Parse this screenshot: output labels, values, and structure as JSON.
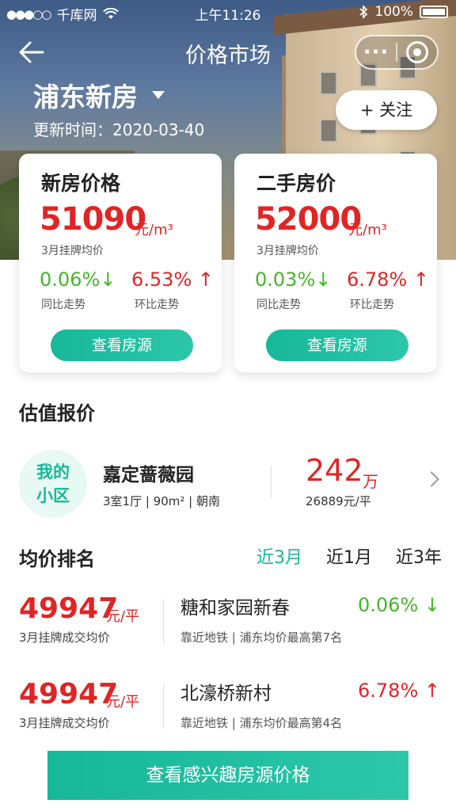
{
  "status_bar": {
    "carrier": "千库网",
    "time": "上午11:26",
    "battery": "100%"
  },
  "nav": {
    "title": "价格市场"
  },
  "header": {
    "district": "浦东新房",
    "updated": "更新时间：2020-03-40",
    "follow_label": "+ 关注"
  },
  "cards": [
    {
      "title": "新房价格",
      "price": "51090",
      "unit": "元/m³",
      "price_label": "3月挂牌均价",
      "yoy": "0.06%",
      "yoy_arrow": "↓",
      "yoy_label": "同比走势",
      "mom": "6.53%",
      "mom_arrow": "↑",
      "mom_label": "环比走势",
      "button": "查看房源"
    },
    {
      "title": "二手房价",
      "price": "52000",
      "unit": "元/m³",
      "price_label": "3月挂牌均价",
      "yoy": "0.03%",
      "yoy_arrow": "↓",
      "yoy_label": "同比走势",
      "mom": "6.78%",
      "mom_arrow": "↑",
      "mom_label": "环比走势",
      "button": "查看房源"
    }
  ],
  "estimate": {
    "section_title": "估值报价",
    "badge_line1": "我的",
    "badge_line2": "小区",
    "community": "嘉定蔷薇园",
    "info": "3室1厅 | 90m² | 朝南",
    "price": "242",
    "price_unit": "万",
    "unit_price": "26889元/平"
  },
  "ranking": {
    "section_title": "均价排名",
    "tabs": [
      "近3月",
      "近1月",
      "近3年"
    ],
    "active_tab": "近3月",
    "rows": [
      {
        "price": "49947",
        "unit": "元/平",
        "label": "3月挂牌成交均价",
        "name": "糖和家园新春",
        "sub": "靠近地铁 | 浦东均价最高第7名",
        "change": "0.06% ↓"
      },
      {
        "price": "49947",
        "unit": "元/平",
        "label": "3月挂牌成交均价",
        "name": "北濠桥新村",
        "sub": "靠近地铁 | 浦东均价最高第4名",
        "change": "6.78% ↑"
      }
    ]
  },
  "cta": {
    "label": "查看感兴趣房源价格"
  },
  "colors": {
    "accent": "#17b79a",
    "price_red": "#e02525",
    "trend_green": "#45b52a"
  }
}
